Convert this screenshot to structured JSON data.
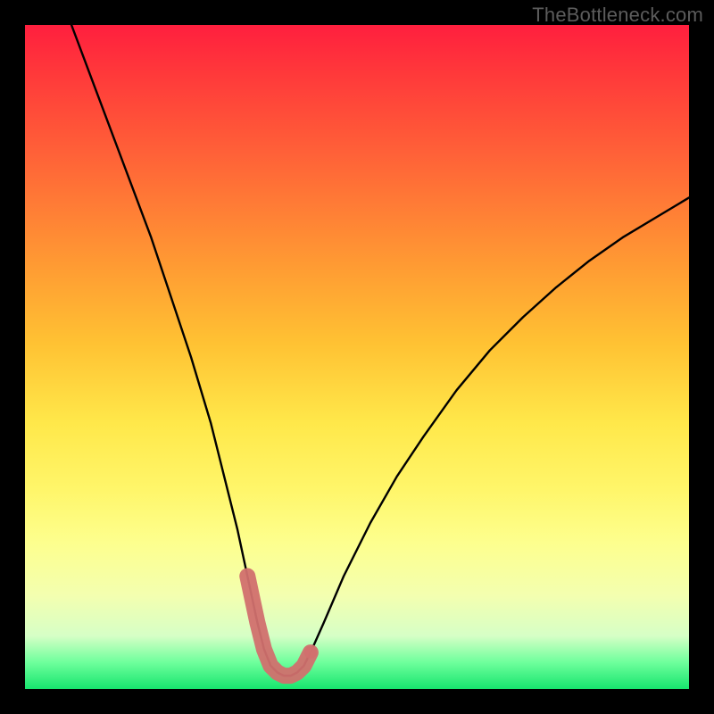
{
  "watermark": {
    "text": "TheBottleneck.com"
  },
  "chart_data": {
    "type": "line",
    "title": "",
    "xlabel": "",
    "ylabel": "",
    "xlim": [
      0,
      100
    ],
    "ylim": [
      0,
      100
    ],
    "grid": false,
    "legend": false,
    "series": [
      {
        "name": "bottleneck-curve",
        "x": [
          7,
          10,
          13,
          16,
          19,
          22,
          25,
          28,
          30,
          32,
          33.5,
          35,
          36,
          37,
          38,
          39,
          40,
          41,
          42,
          43,
          45,
          48,
          52,
          56,
          60,
          65,
          70,
          75,
          80,
          85,
          90,
          95,
          100
        ],
        "y": [
          100,
          92,
          84,
          76,
          68,
          59,
          50,
          40,
          32,
          24,
          17,
          10,
          6,
          3.5,
          2.5,
          2,
          2,
          2.5,
          3.5,
          5.5,
          10,
          17,
          25,
          32,
          38,
          45,
          51,
          56,
          60.5,
          64.5,
          68,
          71,
          74
        ]
      }
    ],
    "highlight": {
      "name": "optimal-range",
      "color": "#d1706e",
      "x": [
        33.5,
        35,
        36,
        37,
        38,
        39,
        40,
        41,
        42,
        43
      ],
      "y": [
        17,
        10,
        6,
        3.5,
        2.5,
        2,
        2,
        2.5,
        3.5,
        5.5
      ]
    },
    "background_gradient": {
      "top": "#ff1f3e",
      "bottom": "#17e56e",
      "meaning": "red = high bottleneck, green = low bottleneck"
    }
  }
}
